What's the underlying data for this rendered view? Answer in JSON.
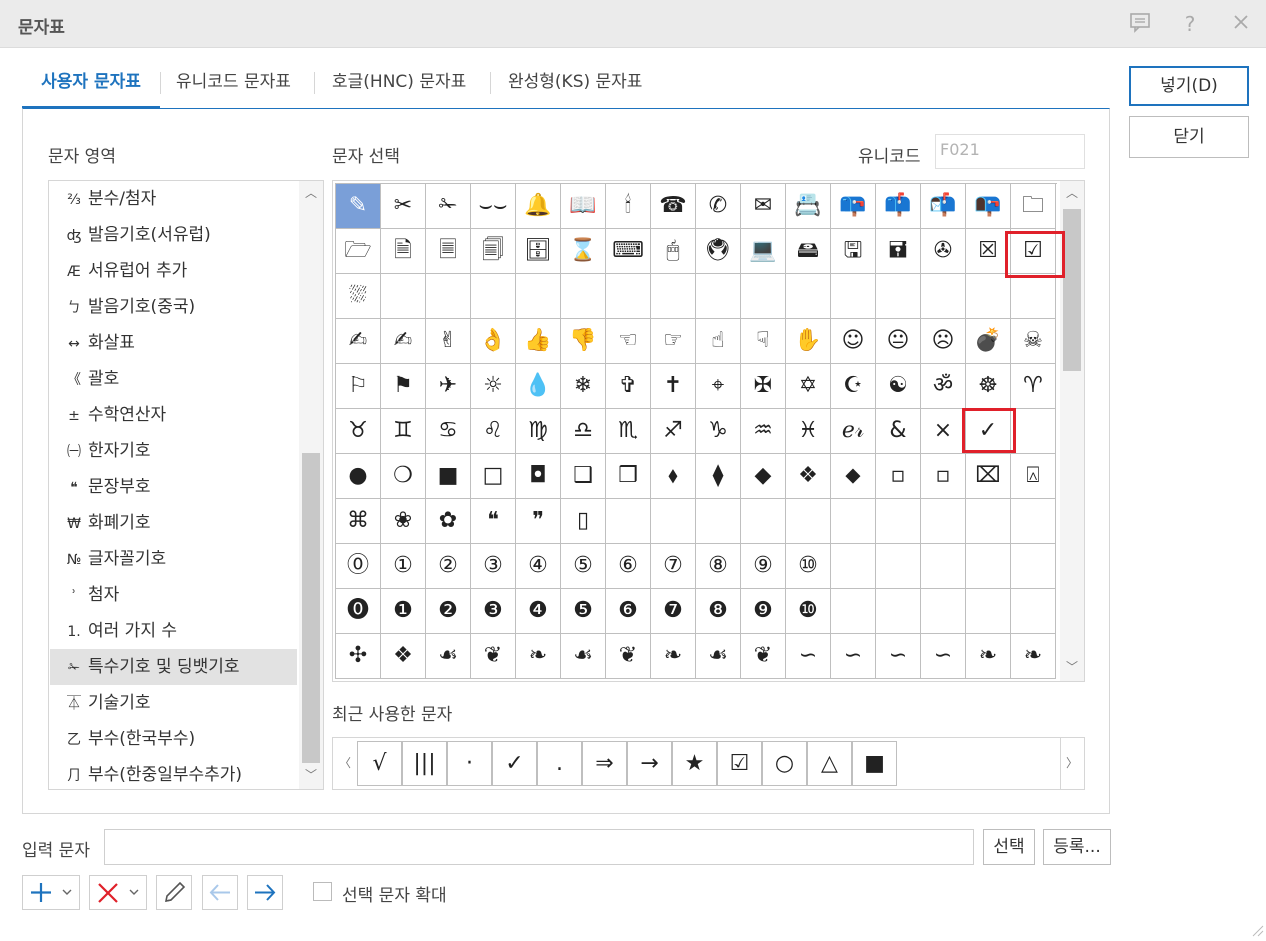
{
  "window": {
    "title": "문자표"
  },
  "tabs": [
    {
      "label": "사용자 문자표",
      "active": true
    },
    {
      "label": "유니코드 문자표",
      "active": false
    },
    {
      "label": "호글(HNC) 문자표",
      "active": false
    },
    {
      "label": "완성형(KS) 문자표",
      "active": false
    }
  ],
  "buttons": {
    "insert": "넣기(D)",
    "close": "닫기",
    "select": "선택",
    "register": "등록..."
  },
  "labels": {
    "char_area": "문자 영역",
    "char_select": "문자 선택",
    "unicode": "유니코드",
    "recent": "최근 사용한 문자",
    "input_chars": "입력 문자",
    "enlarge": "선택 문자 확대"
  },
  "unicode_value": "F021",
  "char_areas": [
    {
      "icon": "⅔",
      "label": "분수/첨자"
    },
    {
      "icon": "ʤ",
      "label": "발음기호(서유럽)"
    },
    {
      "icon": "Æ",
      "label": "서유럽어 추가"
    },
    {
      "icon": "ㄅ",
      "label": "발음기호(중국)"
    },
    {
      "icon": "↔",
      "label": "화살표"
    },
    {
      "icon": "《",
      "label": "괄호"
    },
    {
      "icon": "±",
      "label": "수학연산자"
    },
    {
      "icon": "㈠",
      "label": "한자기호"
    },
    {
      "icon": "❝",
      "label": "문장부호"
    },
    {
      "icon": "₩",
      "label": "화폐기호"
    },
    {
      "icon": "№",
      "label": "글자꼴기호"
    },
    {
      "icon": "ʾ",
      "label": "첨자"
    },
    {
      "icon": "1.",
      "label": "여러 가지 수"
    },
    {
      "icon": "✁",
      "label": "특수기호 및 딩뱃기호",
      "selected": true
    },
    {
      "icon": "⏄",
      "label": "기술기호"
    },
    {
      "icon": "乙",
      "label": "부수(한국부수)"
    },
    {
      "icon": "⺆",
      "label": "부수(한중일부수추가)"
    }
  ],
  "char_grid": [
    [
      "✎",
      "✂",
      "✁",
      "⌣⌣",
      "🔔",
      "📖",
      "🕯",
      "☎",
      "✆",
      "✉",
      "📇",
      "📪",
      "📫",
      "📬",
      "📭",
      "🗀"
    ],
    [
      "🗁",
      "🗎",
      "🗏",
      "🗐",
      "🗄",
      "⌛",
      "⌨",
      "🖱",
      "🖲",
      "💻",
      "🖴",
      "🖫",
      "🖬",
      "✇",
      "☒",
      "☑"
    ],
    [
      "⛆",
      "",
      "",
      "",
      "",
      "",
      "",
      "",
      "",
      "",
      "",
      "",
      "",
      "",
      "",
      ""
    ],
    [
      "✍",
      "✍",
      "✌",
      "👌",
      "👍",
      "👎",
      "☜",
      "☞",
      "☝",
      "☟",
      "✋",
      "☺",
      "😐",
      "☹",
      "💣",
      "☠"
    ],
    [
      "⚐",
      "⚑",
      "✈",
      "☼",
      "💧",
      "❄",
      "✞",
      "✝",
      "⌖",
      "✠",
      "✡",
      "☪",
      "☯",
      "ॐ",
      "☸",
      "♈"
    ],
    [
      "♉",
      "♊",
      "♋",
      "♌",
      "♍",
      "♎",
      "♏",
      "♐",
      "♑",
      "♒",
      "♓",
      "ℯ𝓇",
      "&",
      "×",
      "✓",
      ""
    ],
    [
      "●",
      "❍",
      "■",
      "□",
      "◘",
      "❑",
      "❒",
      "⬧",
      "⧫",
      "◆",
      "❖",
      "⬥",
      "▫",
      "▫",
      "⌧",
      "⍓"
    ],
    [
      "⌘",
      "❀",
      "✿",
      "❝",
      "❞",
      "▯",
      "",
      "",
      "",
      "",
      "",
      "",
      "",
      "",
      "",
      ""
    ],
    [
      "⓪",
      "①",
      "②",
      "③",
      "④",
      "⑤",
      "⑥",
      "⑦",
      "⑧",
      "⑨",
      "⑩",
      "",
      "",
      "",
      "",
      ""
    ],
    [
      "⓿",
      "❶",
      "❷",
      "❸",
      "❹",
      "❺",
      "❻",
      "❼",
      "❽",
      "❾",
      "❿",
      "",
      "",
      "",
      "",
      ""
    ],
    [
      "✣",
      "❖",
      "☙",
      "❦",
      "❧",
      "☙",
      "❦",
      "❧",
      "☙",
      "❦",
      "∽",
      "∽",
      "∽",
      "∽",
      "❧",
      "❧"
    ]
  ],
  "recent_chars": [
    "√",
    "|||",
    "·",
    "✓",
    ".",
    "⇒",
    "→",
    "★",
    "☑",
    "○",
    "△",
    "■"
  ],
  "colors": {
    "accent": "#1e73be",
    "highlight": "#e0202a",
    "selected_cell": "#7a9fd8",
    "list_selected": "#e2e2e2"
  },
  "icons": {
    "feedback": "chat-icon",
    "help": "question-icon",
    "close": "close-icon",
    "add": "plus-icon",
    "delete": "x-icon",
    "edit": "pencil-icon",
    "prev": "arrow-left-icon",
    "next": "arrow-right-icon"
  }
}
